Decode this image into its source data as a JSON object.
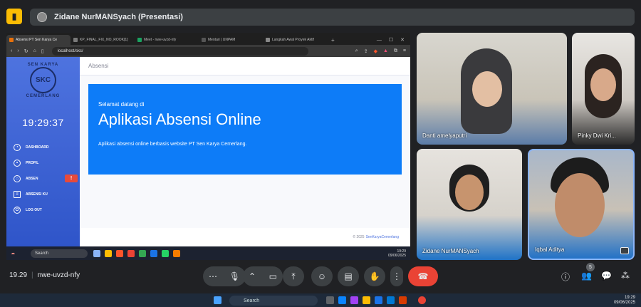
{
  "meet": {
    "presenter_title": "Zidane NurMANSyach (Presentasi)",
    "time": "19.29",
    "code": "nwe-uvzd-nfy",
    "people_count": "5"
  },
  "browser": {
    "tabs": [
      {
        "label": "Absensi PT Sen Karya Ce",
        "color": "#e8710a"
      },
      {
        "label": "KP_FINAL_FIX_NO_ROOK[1]",
        "color": "#7a7a7a"
      },
      {
        "label": "Meet - nwe-uvzd-nfy",
        "color": "#1aa260"
      },
      {
        "label": "Mentari | UNPAM",
        "color": "#555"
      },
      {
        "label": "Langkah Awal Proyek Aktif",
        "color": "#888"
      }
    ],
    "url": "localhost/skc/"
  },
  "app": {
    "logo_top": "SEN KARYA",
    "logo_mark": "SKC",
    "logo_bottom": "CEMERLANG",
    "clock": "19:29:37",
    "menu": [
      {
        "label": "DASHBOARD",
        "icon": "dashboard-icon"
      },
      {
        "label": "PROFIL",
        "icon": "user-icon"
      },
      {
        "label": "ABSEN",
        "icon": "tag-icon"
      },
      {
        "label": "ABSENSI KU",
        "icon": "list-icon"
      },
      {
        "label": "LOG OUT",
        "icon": "power-icon"
      }
    ],
    "header": "Absensi",
    "welcome_small": "Selamat datang di",
    "welcome_big": "Aplikasi Absensi Online",
    "welcome_desc": "Aplikasi absensi online berbasis website PT Sen Karya Cemerlang.",
    "footer_text": "© 2025",
    "footer_link": "SenKaryaCemerlang"
  },
  "inner_taskbar": {
    "search": "Search",
    "time": "19:29",
    "date": "09/06/2025"
  },
  "participants": [
    {
      "name": "Danti amelyaputri"
    },
    {
      "name": "Pinky Dwi Kri..."
    },
    {
      "name": "Zidane NurMANSyach"
    },
    {
      "name": "Iqbal Aditya"
    }
  ],
  "windows_taskbar": {
    "search": "Search",
    "time": "19:29",
    "date": "09/06/2025"
  },
  "colors": {
    "sidebar": "#4e73df",
    "jumbotron": "#0d7cf8",
    "end_call": "#ea4335",
    "meet_bg": "#202124"
  }
}
